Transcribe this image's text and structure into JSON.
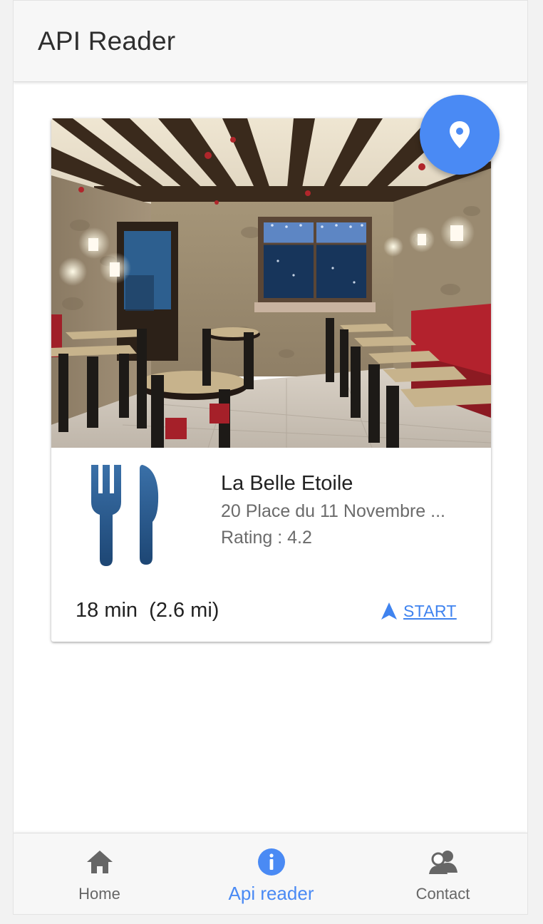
{
  "app": {
    "title": "API Reader"
  },
  "place": {
    "name": "La Belle Etoile",
    "address": "20 Place du 11 Novembre ...",
    "rating": "Rating : 4.2",
    "travel": "18 min  (2.6 mi)",
    "start_label": "START",
    "photo_subject": "restaurant-interior"
  },
  "bottom_nav": {
    "items": [
      {
        "label": "Home",
        "icon": "home-icon",
        "active": false
      },
      {
        "label": "Api reader",
        "icon": "info-icon",
        "active": true
      },
      {
        "label": "Contact",
        "icon": "contacts-icon",
        "active": false
      }
    ]
  },
  "colors": {
    "accent": "#4a8af4",
    "link": "#3f83ef",
    "cutlery": "#2b5c90",
    "text_secondary": "#6b6b6b",
    "bar_bg": "#f7f7f7"
  }
}
